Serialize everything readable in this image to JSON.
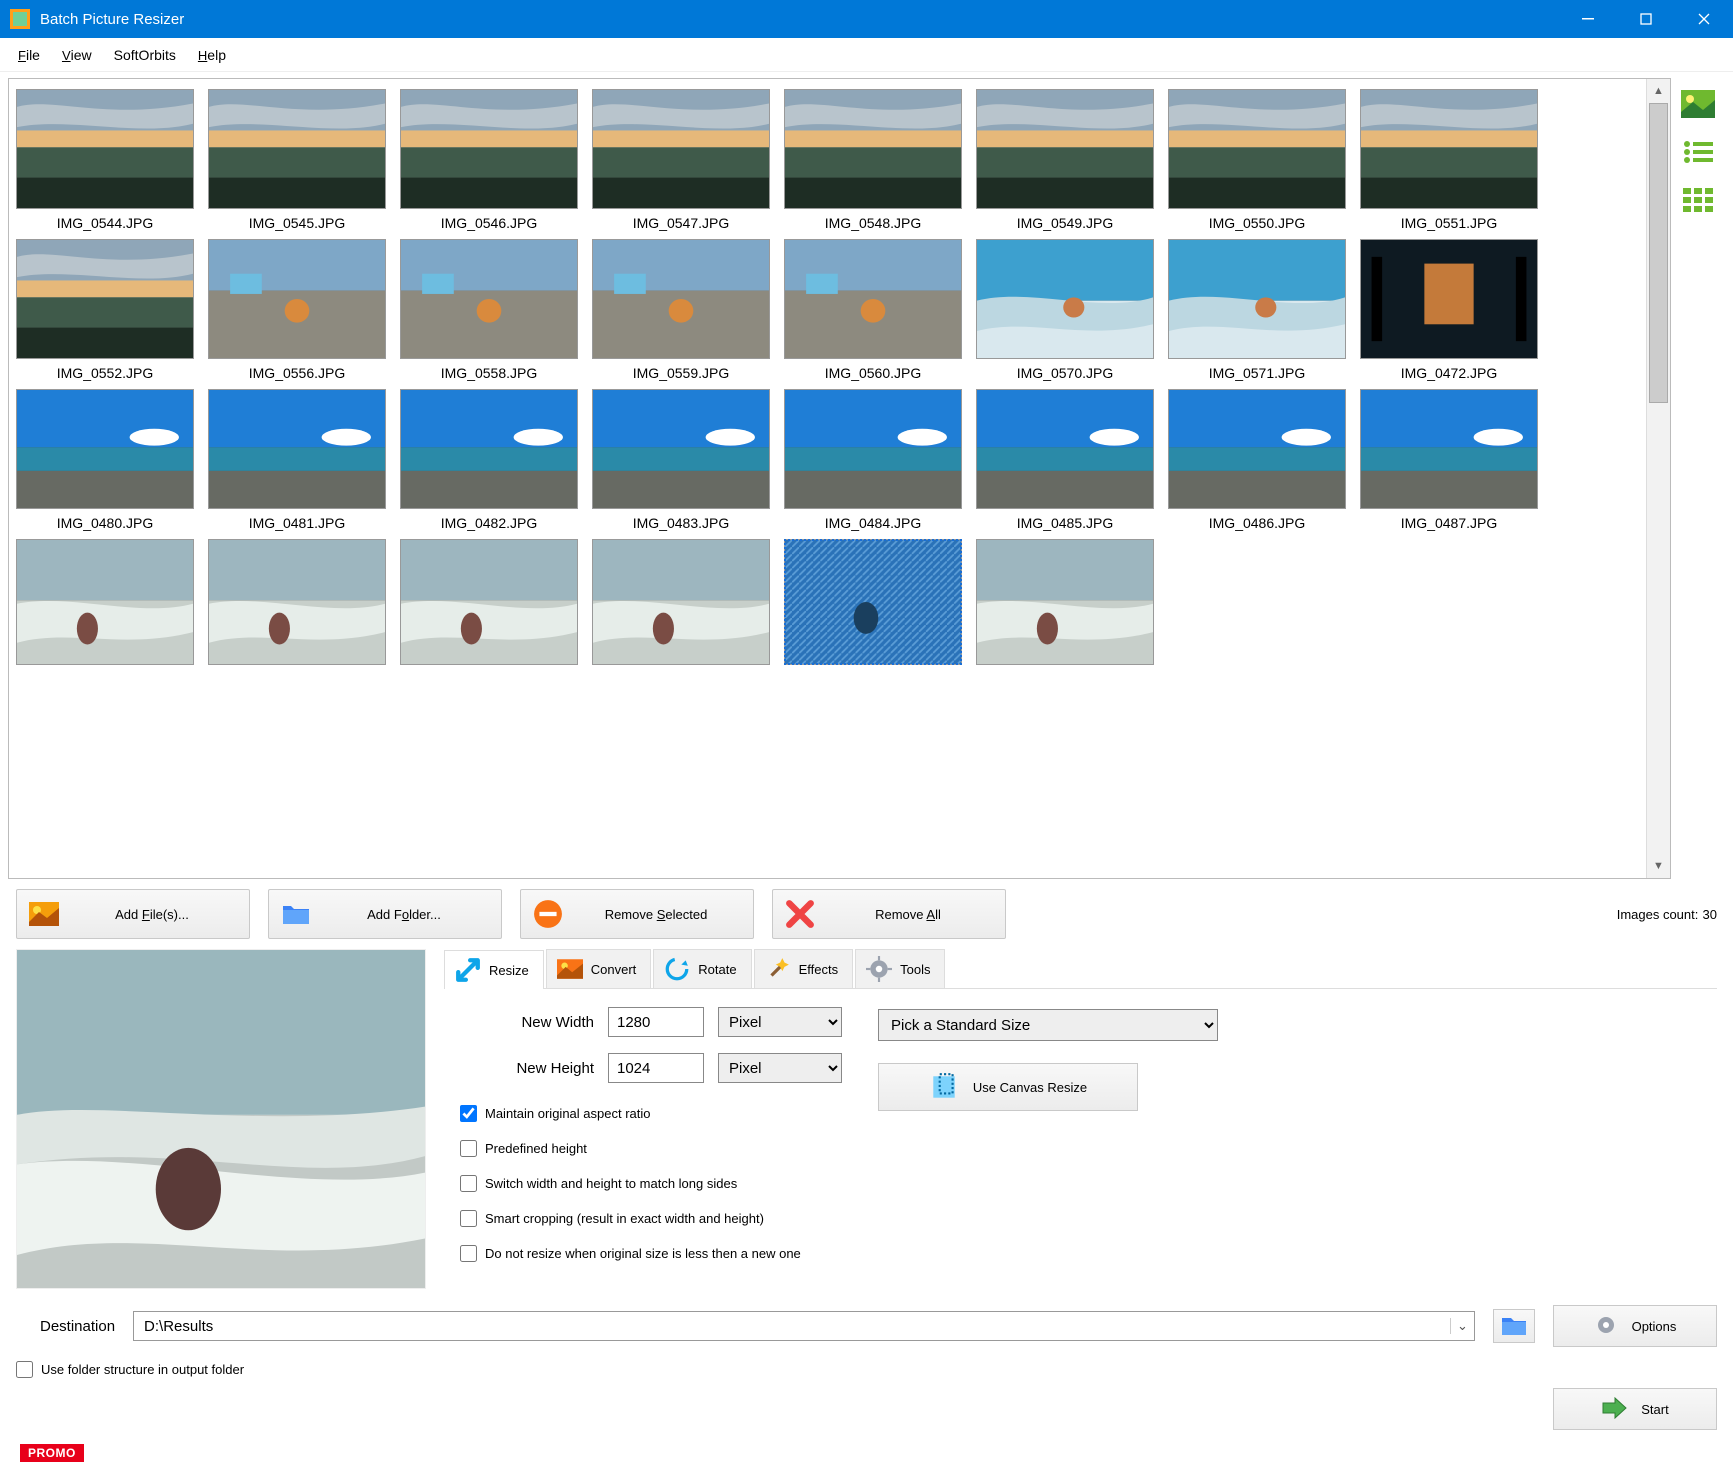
{
  "window": {
    "title": "Batch Picture Resizer"
  },
  "menu": {
    "file": "File",
    "view": "View",
    "softorbits": "SoftOrbits",
    "help": "Help"
  },
  "thumbnails": [
    {
      "label": "IMG_0544.JPG",
      "variant": "sunset"
    },
    {
      "label": "IMG_0545.JPG",
      "variant": "sunset"
    },
    {
      "label": "IMG_0546.JPG",
      "variant": "sunset"
    },
    {
      "label": "IMG_0547.JPG",
      "variant": "sunset"
    },
    {
      "label": "IMG_0548.JPG",
      "variant": "sunset"
    },
    {
      "label": "IMG_0549.JPG",
      "variant": "sunset"
    },
    {
      "label": "IMG_0550.JPG",
      "variant": "sunset"
    },
    {
      "label": "IMG_0551.JPG",
      "variant": "sunset"
    },
    {
      "label": "IMG_0552.JPG",
      "variant": "sunset"
    },
    {
      "label": "IMG_0556.JPG",
      "variant": "beach"
    },
    {
      "label": "IMG_0558.JPG",
      "variant": "beach"
    },
    {
      "label": "IMG_0559.JPG",
      "variant": "beach"
    },
    {
      "label": "IMG_0560.JPG",
      "variant": "beach"
    },
    {
      "label": "IMG_0570.JPG",
      "variant": "wave"
    },
    {
      "label": "IMG_0571.JPG",
      "variant": "wave"
    },
    {
      "label": "IMG_0472.JPG",
      "variant": "dark"
    },
    {
      "label": "IMG_0480.JPG",
      "variant": "sea"
    },
    {
      "label": "IMG_0481.JPG",
      "variant": "sea"
    },
    {
      "label": "IMG_0482.JPG",
      "variant": "sea"
    },
    {
      "label": "IMG_0483.JPG",
      "variant": "sea"
    },
    {
      "label": "IMG_0484.JPG",
      "variant": "sea"
    },
    {
      "label": "IMG_0485.JPG",
      "variant": "sea"
    },
    {
      "label": "IMG_0486.JPG",
      "variant": "sea"
    },
    {
      "label": "IMG_0487.JPG",
      "variant": "sea"
    },
    {
      "label": "",
      "variant": "cloud",
      "partial": true
    },
    {
      "label": "",
      "variant": "cloud",
      "partial": true
    },
    {
      "label": "",
      "variant": "cloud",
      "partial": true
    },
    {
      "label": "",
      "variant": "cloud",
      "partial": true
    },
    {
      "label": "",
      "variant": "cloud",
      "partial": true,
      "selected": true
    },
    {
      "label": "",
      "variant": "cloud",
      "partial": true
    }
  ],
  "actions": {
    "add_files": "Add File(s)...",
    "add_folder": "Add Folder...",
    "remove_selected": "Remove Selected",
    "remove_all": "Remove All",
    "count_label": "Images count:",
    "count_value": "30"
  },
  "tabs": {
    "resize": "Resize",
    "convert": "Convert",
    "rotate": "Rotate",
    "effects": "Effects",
    "tools": "Tools"
  },
  "resize": {
    "new_width_label": "New Width",
    "new_width_value": "1280",
    "new_height_label": "New Height",
    "new_height_value": "1024",
    "unit": "Pixel",
    "std_size": "Pick a Standard Size",
    "canvas_btn": "Use Canvas Resize",
    "checks": {
      "aspect": "Maintain original aspect ratio",
      "predef": "Predefined height",
      "switch": "Switch width and height to match long sides",
      "smart": "Smart cropping (result in exact width and height)",
      "noresize": "Do not resize when original size is less then a new one"
    }
  },
  "destination": {
    "label": "Destination",
    "path": "D:\\Results",
    "use_folder_structure": "Use folder structure in output folder",
    "options": "Options",
    "start": "Start"
  },
  "promo": "PROMO"
}
